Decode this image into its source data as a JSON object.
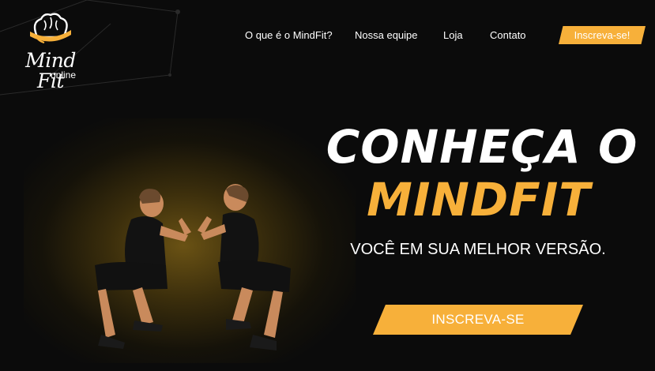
{
  "logo": {
    "brand": "Mind Fit",
    "sub": "online",
    "icon": "brain-icon"
  },
  "nav": {
    "items": [
      {
        "label": "O que é o MindFit?"
      },
      {
        "label": "Nossa equipe"
      },
      {
        "label": "Loja"
      },
      {
        "label": "Contato"
      }
    ],
    "cta_label": "Inscreva-se!"
  },
  "hero": {
    "title_line1": "CONHEÇA O",
    "title_line2": "MINDFIT",
    "tagline": "VOCÊ EM SUA MELHOR VERSÃO.",
    "cta_label": "INSCREVA-SE",
    "image_icon": "athletes-squat-image"
  },
  "colors": {
    "background": "#0b0b0b",
    "accent": "#f7b03a",
    "text": "#ffffff"
  }
}
